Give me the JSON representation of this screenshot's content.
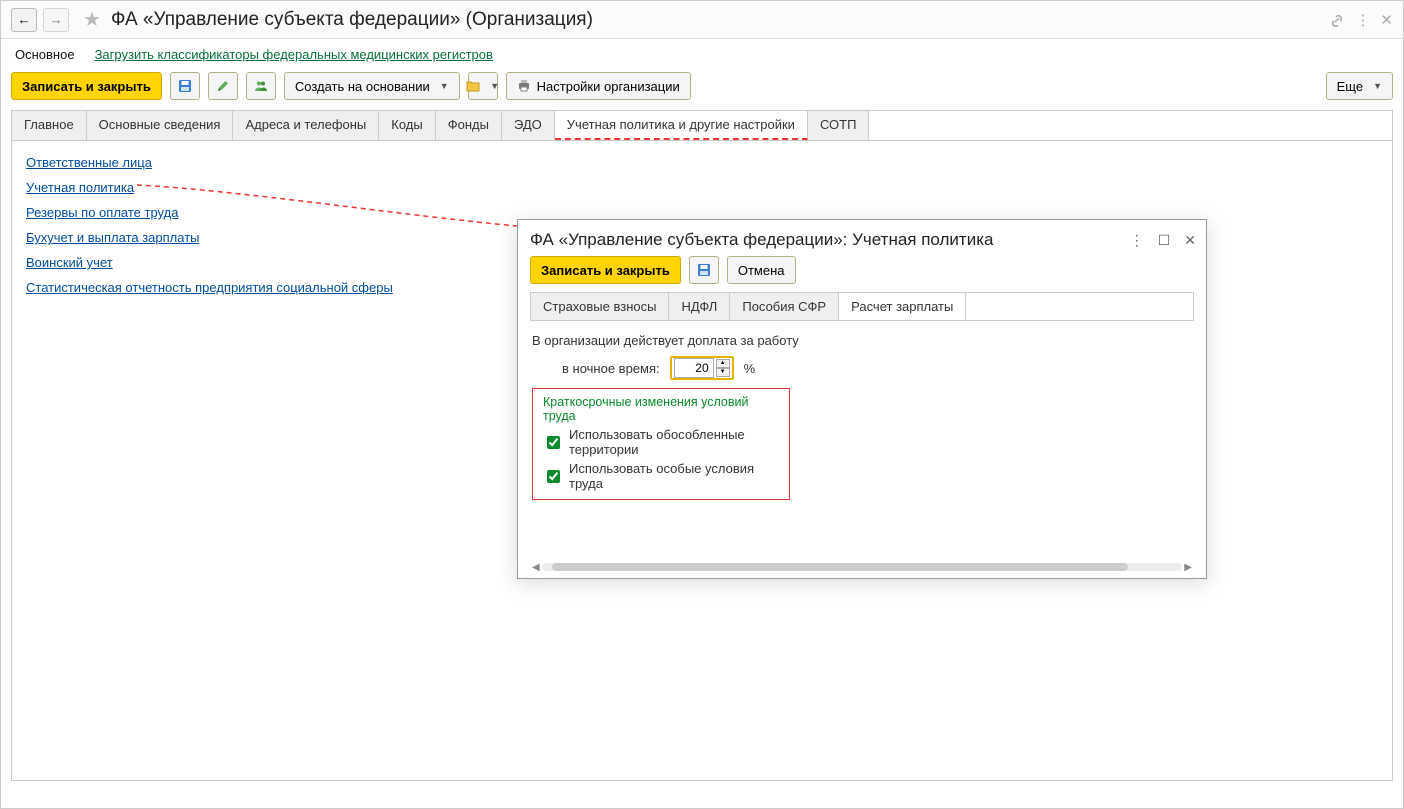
{
  "header": {
    "title": "ФА «Управление субъекта федерации» (Организация)"
  },
  "subnav": {
    "tab": "Основное",
    "link": "Загрузить классификаторы федеральных медицинских регистров"
  },
  "toolbar": {
    "save_close": "Записать и закрыть",
    "create_based": "Создать на основании",
    "settings": "Настройки организации",
    "more": "Еще"
  },
  "main_tabs": [
    "Главное",
    "Основные сведения",
    "Адреса и телефоны",
    "Коды",
    "Фонды",
    "ЭДО",
    "Учетная политика и другие настройки",
    "СОТП"
  ],
  "main_tabs_active_index": 6,
  "links": [
    "Ответственные лица",
    "Учетная политика",
    "Резервы по оплате труда",
    "Бухучет и выплата зарплаты",
    "Воинский учет",
    "Статистическая отчетность предприятия социальной сферы"
  ],
  "popup": {
    "title": "ФА «Управление субъекта федерации»: Учетная политика",
    "save_close": "Записать и закрыть",
    "cancel": "Отмена",
    "tabs": [
      "Страховые взносы",
      "НДФЛ",
      "Пособия СФР",
      "Расчет зарплаты"
    ],
    "active_tab_index": 3,
    "body": {
      "intro": "В организации действует доплата за работу",
      "night_label": "в ночное время:",
      "night_value": "20",
      "percent": "%",
      "group_title": "Краткосрочные изменения условий труда",
      "check1": "Использовать обособленные территории",
      "check2": "Использовать особые условия труда"
    }
  }
}
